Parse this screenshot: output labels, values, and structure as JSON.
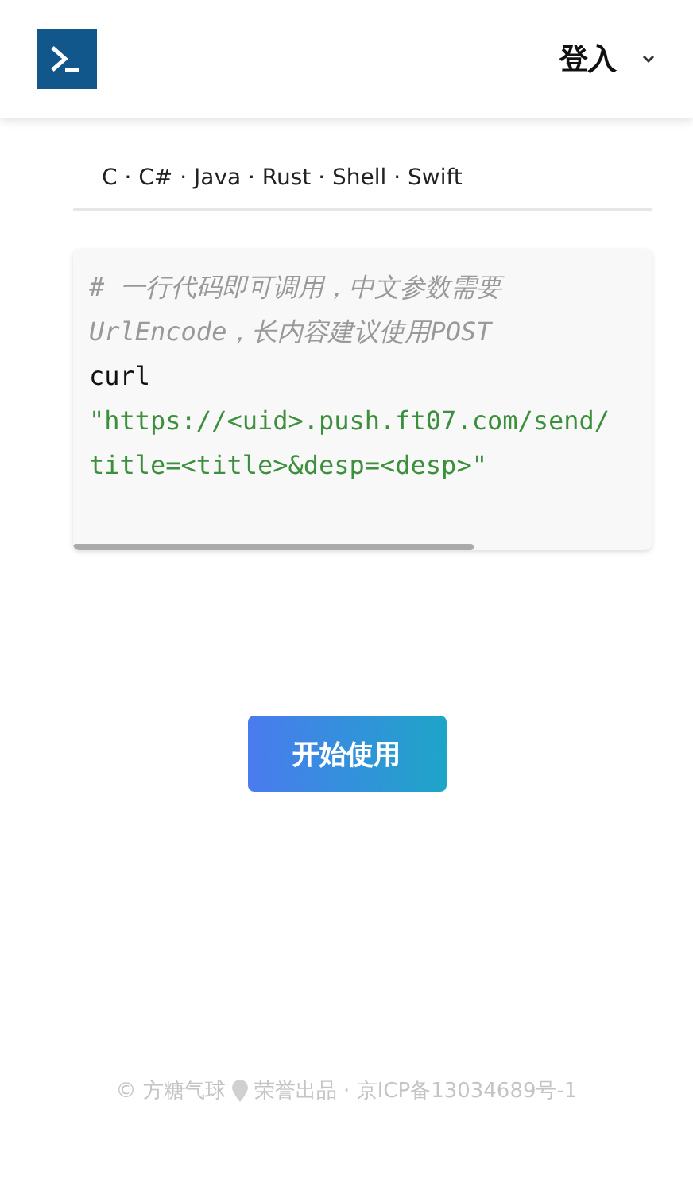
{
  "header": {
    "login": "登入"
  },
  "languages": [
    "C · C# · Java · Rust · Shell · Swift"
  ],
  "code": [
    {
      "kind": "comment",
      "text": "# 一行代码即可调用，中文参数需要"
    },
    {
      "kind": "comment",
      "text": "UrlEncode，长内容建议使用POST"
    },
    {
      "kind": "plain",
      "text": "curl"
    },
    {
      "kind": "string",
      "text": "\"https://<uid>.push.ft07.com/send/"
    },
    {
      "kind": "string",
      "text": "title=<title>&desp=<desp>\""
    }
  ],
  "start_button": "开始使用",
  "footer": {
    "copyright": "© 方糖气球",
    "credit": "荣誉出品 · 京ICP备13034689号-1"
  }
}
